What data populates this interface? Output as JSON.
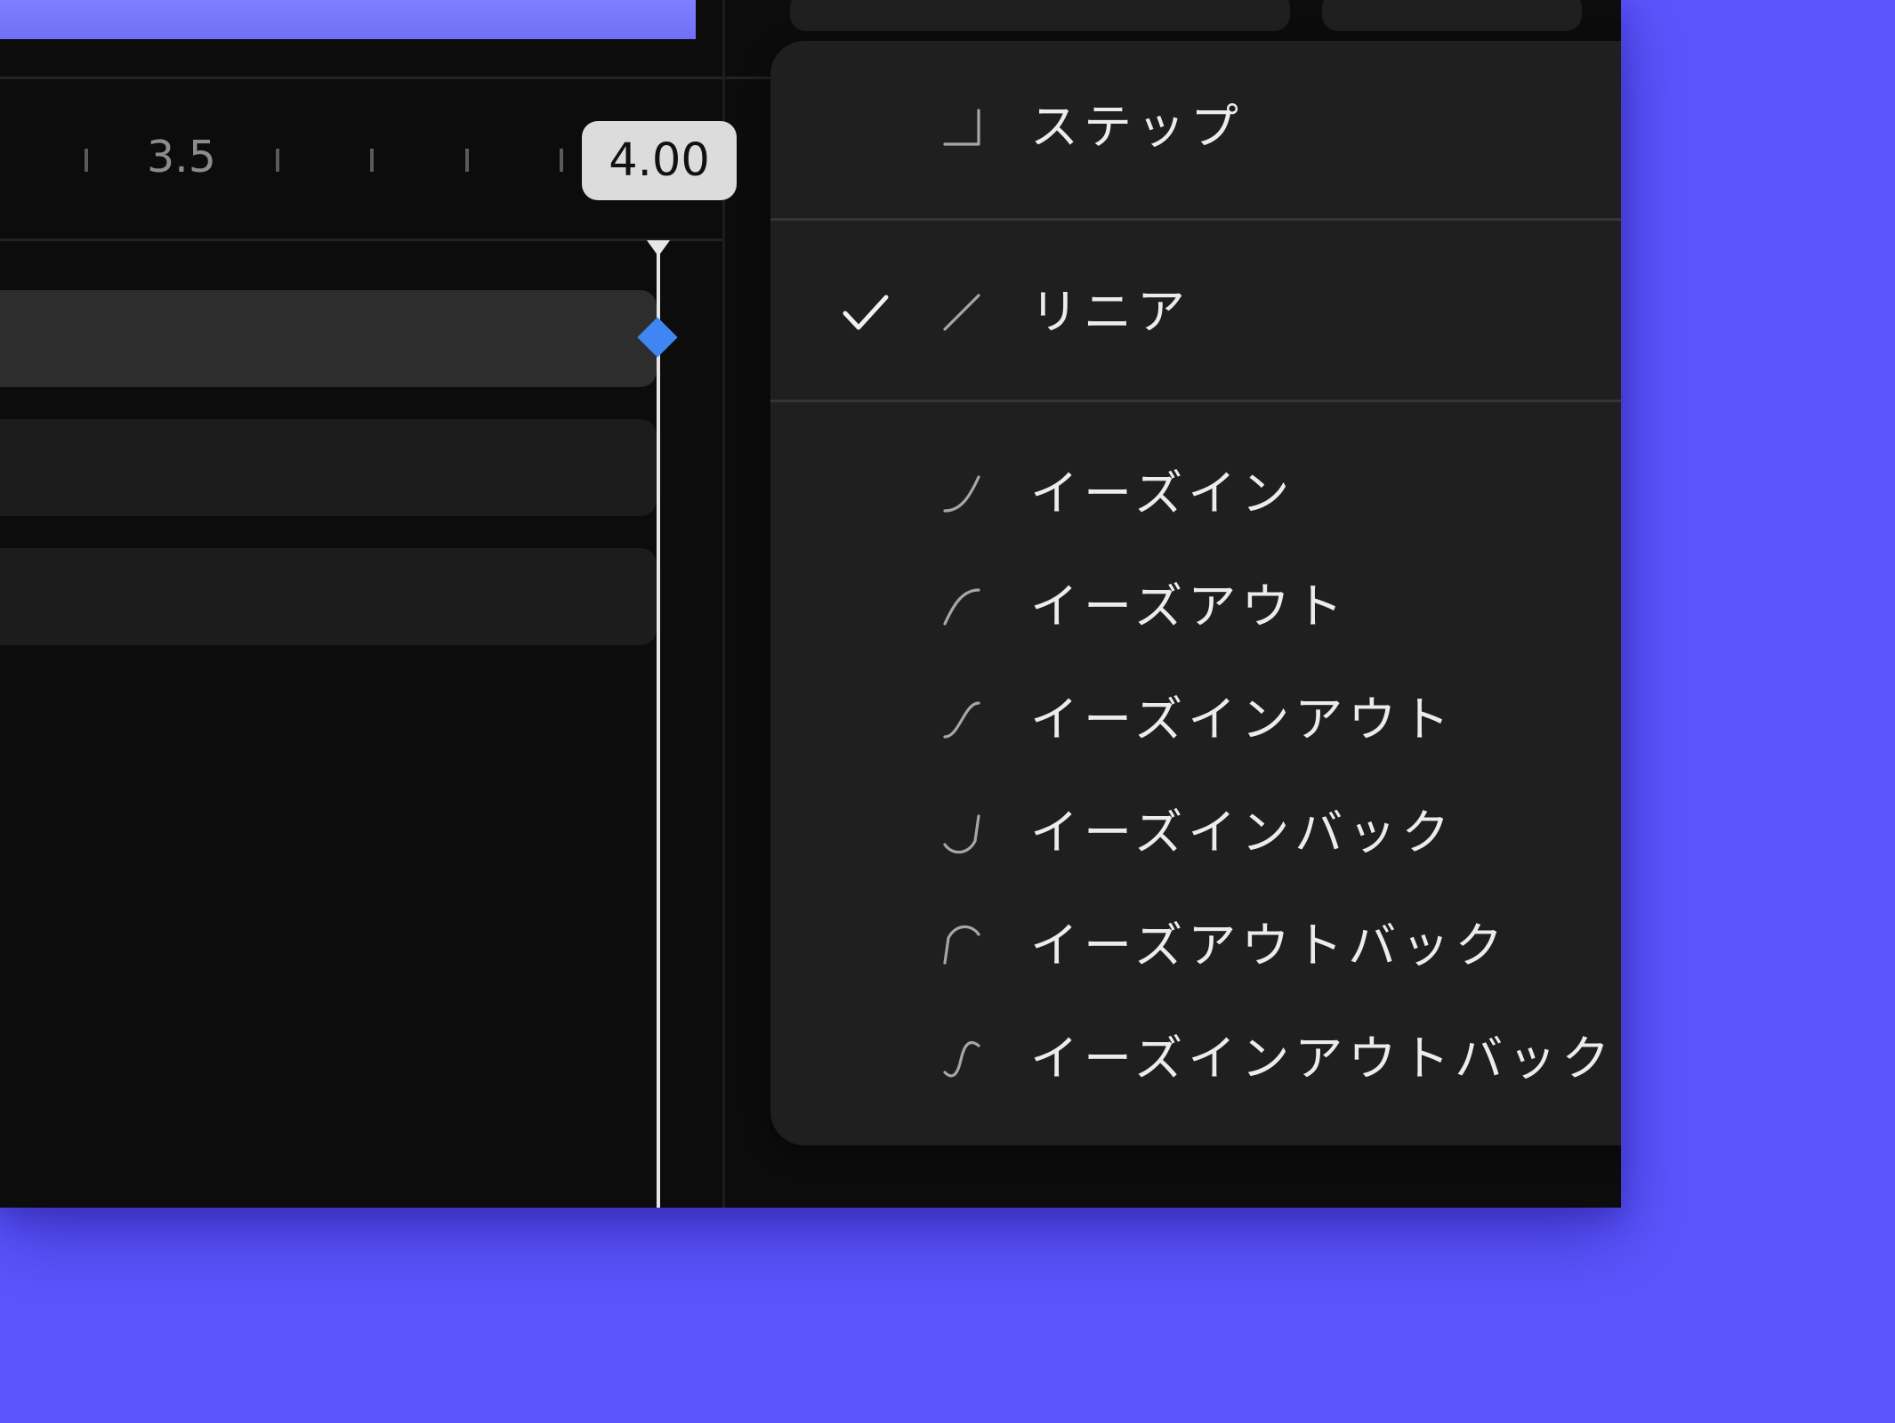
{
  "timeline": {
    "ruler_label": "3.5",
    "current_time": "4.00",
    "accent_color": "#3f86f2",
    "background_color": "#5c55fd"
  },
  "easing_menu": {
    "selected": "リニア",
    "items": [
      {
        "label": "ステップ",
        "icon": "step-curve-icon",
        "checked": false
      },
      {
        "label": "リニア",
        "icon": "linear-curve-icon",
        "checked": true
      },
      {
        "label": "イーズイン",
        "icon": "ease-in-curve-icon",
        "checked": false
      },
      {
        "label": "イーズアウト",
        "icon": "ease-out-curve-icon",
        "checked": false
      },
      {
        "label": "イーズインアウト",
        "icon": "ease-in-out-curve-icon",
        "checked": false
      },
      {
        "label": "イーズインバック",
        "icon": "ease-in-back-curve-icon",
        "checked": false
      },
      {
        "label": "イーズアウトバック",
        "icon": "ease-out-back-curve-icon",
        "checked": false
      },
      {
        "label": "イーズインアウトバック",
        "icon": "ease-in-out-back-curve-icon",
        "checked": false
      }
    ]
  }
}
